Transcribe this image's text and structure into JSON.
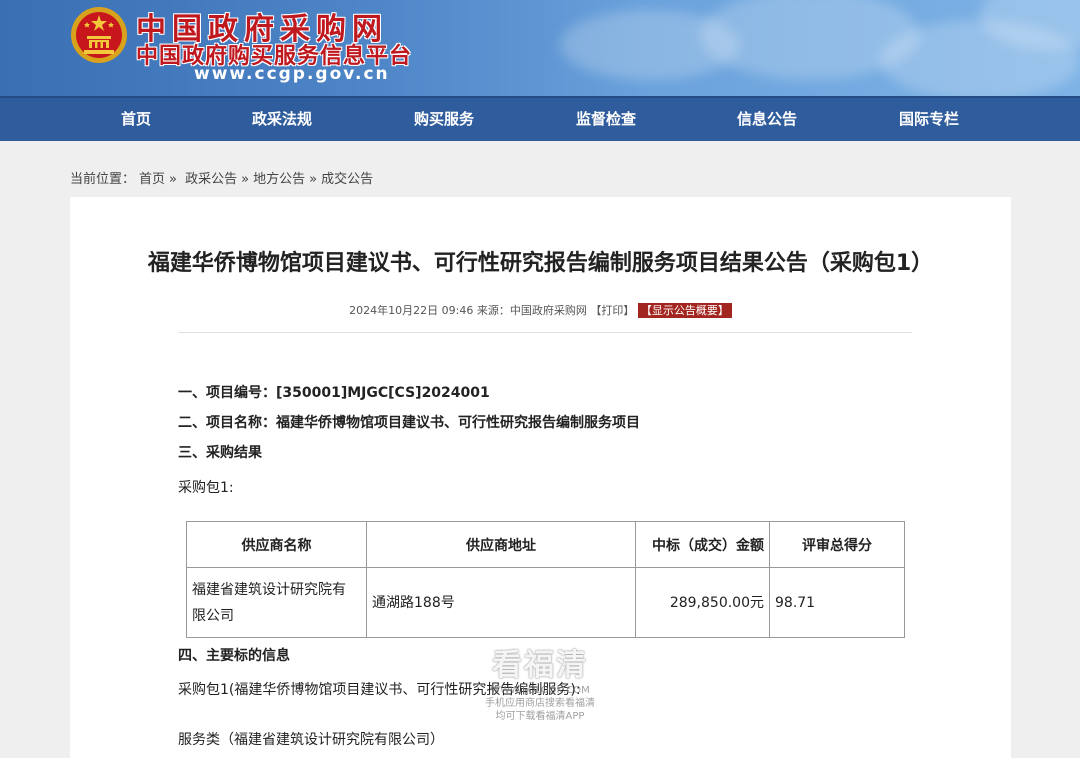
{
  "header": {
    "title": "中国政府采购网",
    "subtitle": "中国政府购买服务信息平台",
    "url": "www.ccgp.gov.cn",
    "emblem_icon": "national-emblem-icon"
  },
  "nav": {
    "items": [
      "首页",
      "政采法规",
      "购买服务",
      "监督检查",
      "信息公告",
      "国际专栏"
    ]
  },
  "breadcrumb": {
    "prefix": "当前位置：",
    "items": [
      "首页",
      "政采公告",
      "地方公告",
      "成交公告"
    ],
    "separator": "»"
  },
  "article": {
    "title": "福建华侨博物馆项目建议书、可行性研究报告编制服务项目结果公告（采购包1）",
    "meta_date": "2024年10月22日 09:46",
    "meta_source": "来源：中国政府采购网",
    "print_label": "【打印】",
    "summary_label": "【显示公告概要】",
    "item1": "一、项目编号：[350001]MJGC[CS]2024001",
    "item2": "二、项目名称：福建华侨博物馆项目建议书、可行性研究报告编制服务项目",
    "item3": "三、采购结果",
    "package": "采购包1:",
    "table": {
      "headers": [
        "供应商名称",
        "供应商地址",
        "中标（成交）金额",
        "评审总得分"
      ],
      "rows": [
        {
          "name_line1": "福建省建筑设计研究院有",
          "name_line2": "限公司",
          "address": "通湖路188号",
          "amount": "289,850.00元",
          "score": "98.71"
        }
      ]
    },
    "item4": "四、主要标的信息",
    "package_detail": "采购包1(福建华侨博物馆项目建议书、可行性研究报告编制服务):",
    "service_class": "服务类（福建省建筑设计研究院有限公司）"
  },
  "watermark": {
    "big": "看福清",
    "line1": "WWW.FQLOOK.COM",
    "line2": "手机应用商店搜索看福清",
    "line3": "均可下载看福清APP"
  },
  "colors": {
    "nav_bg": "#2f5c9c",
    "title_red": "#c0181f",
    "badge_red": "#a3251f"
  }
}
